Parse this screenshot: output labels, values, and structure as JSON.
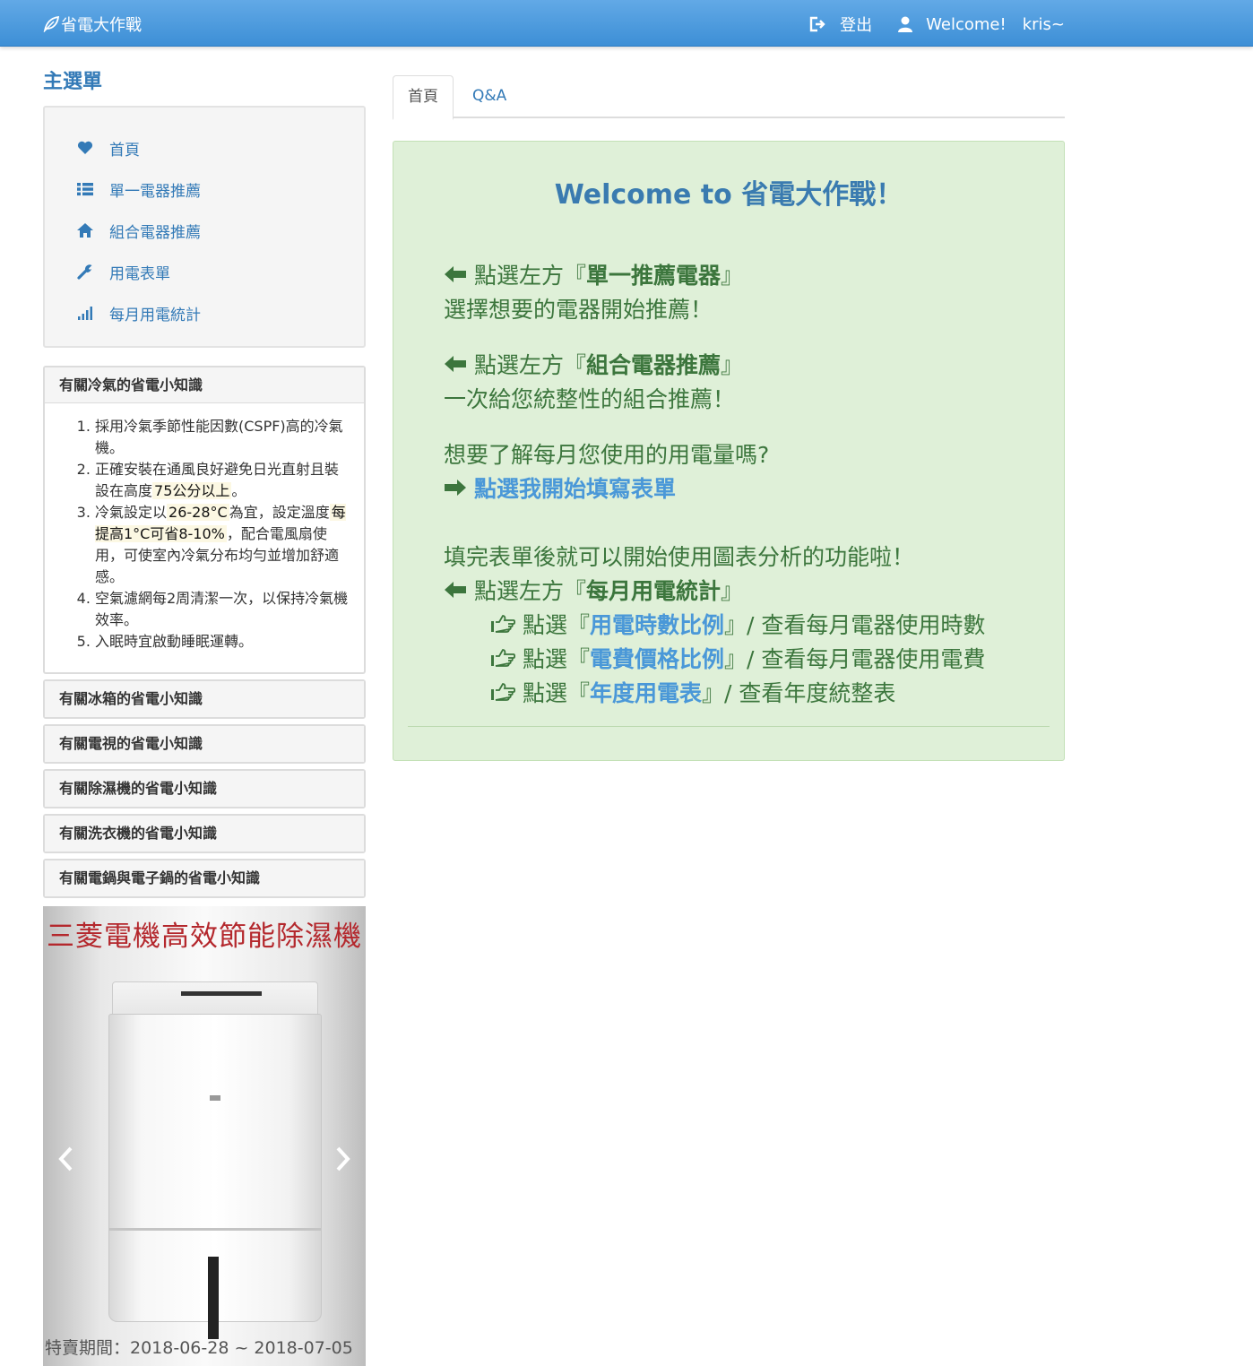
{
  "navbar": {
    "brand": "省電大作戰",
    "logout": "登出",
    "welcome": "Welcome!",
    "user": "kris~"
  },
  "sidebar": {
    "title": "主選單",
    "items": [
      {
        "label": "首頁",
        "icon": "heart-icon"
      },
      {
        "label": "單一電器推薦",
        "icon": "list-icon"
      },
      {
        "label": "組合電器推薦",
        "icon": "home-icon"
      },
      {
        "label": "用電表單",
        "icon": "wrench-icon"
      },
      {
        "label": "每月用電統計",
        "icon": "signal-icon"
      }
    ]
  },
  "tips": {
    "aircon": {
      "title": "有關冷氣的省電小知識",
      "items": [
        {
          "pre": "採用冷氣季節性能因數(CSPF)高的冷氣機。"
        },
        {
          "pre": "正確安裝在通風良好避免日光直射且裝設在高度",
          "hl": "75公分以上",
          "post": "。"
        },
        {
          "pre": "冷氣設定以",
          "hl": "26-28°C",
          "mid": "為宜，設定溫度",
          "hl2": "每提高1°C可省8-10%",
          "post": "，配合電風扇使用，可使室內冷氣分布均勻並增加舒適感。"
        },
        {
          "pre": "空氣濾網每2周清潔一次，以保持冷氣機效率。"
        },
        {
          "pre": "入眠時宜啟動睡眠運轉。"
        }
      ]
    },
    "collapsed": [
      "有關冰箱的省電小知識",
      "有關電視的省電小知識",
      "有關除濕機的省電小知識",
      "有關洗衣機的省電小知識",
      "有關電鍋與電子鍋的省電小知識"
    ]
  },
  "ad": {
    "title": "三菱電機高效節能除濕機",
    "period": "特賣期間：2018-06-28 ~ 2018-07-05"
  },
  "tabs": [
    "首頁",
    "Q&A"
  ],
  "welcome": {
    "title": "Welcome to 省電大作戰！",
    "block1_a": "點選左方『",
    "block1_b": "單一推薦電器",
    "block1_c": "』",
    "block1_line2": "選擇想要的電器開始推薦！",
    "block2_a": "點選左方『",
    "block2_b": "組合電器推薦",
    "block2_c": "』",
    "block2_line2": "一次給您統整性的組合推薦！",
    "block3_line1": "想要了解每月您使用的用電量嗎?",
    "block3_link": "點選我開始填寫表單",
    "block4_line1": "填完表單後就可以開始使用圖表分析的功能啦！",
    "block4_a": "點選左方『",
    "block4_b": "每月用電統計",
    "block4_c": "』",
    "subs": [
      {
        "pre": "點選『",
        "link": "用電時數比例",
        "post": "』/ 查看每月電器使用時數"
      },
      {
        "pre": "點選『",
        "link": "電費價格比例",
        "post": "』/ 查看每月電器使用電費"
      },
      {
        "pre": "點選『",
        "link": "年度用電表",
        "post": "』/ 查看年度統整表"
      }
    ]
  },
  "colors": {
    "navbar": "#4a9be0",
    "accent": "#337ab7",
    "welcome_bg": "#dff0d8",
    "welcome_text": "#3c763d",
    "highlight": "#fcf8e3"
  }
}
